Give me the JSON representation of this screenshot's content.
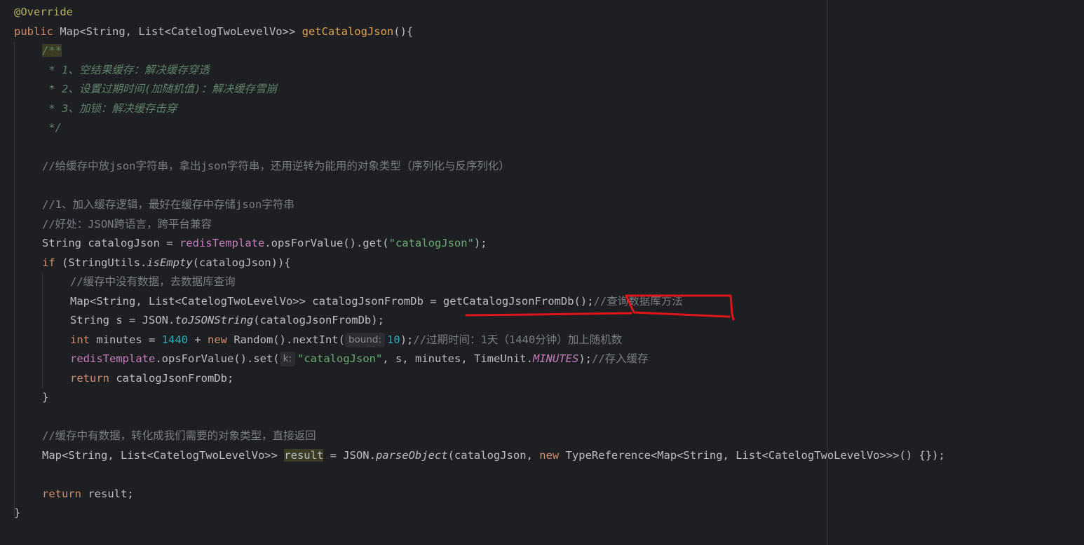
{
  "code": {
    "l1_annotation": "@Override",
    "l2_public": "public",
    "l2_type": " Map<String, List<CatelogTwoLevelVo>> ",
    "l2_method": "getCatalogJson",
    "l2_end": "(){",
    "l3_doc_open": "/**",
    "l4_doc": " * 1、空结果缓存：解决缓存穿透",
    "l5_doc": " * 2、设置过期时间(加随机值)：解决缓存雪崩",
    "l6_doc": " * 3、加锁：解决缓存击穿",
    "l7_doc": " */",
    "l9_comment": "//给缓存中放json字符串，拿出json字符串，还用逆转为能用的对象类型（序列化与反序列化）",
    "l11_comment": "//1、加入缓存逻辑，最好在缓存中存储json字符串",
    "l12_comment": "//好处：JSON跨语言，跨平台兼容",
    "l13_a": "String catalogJson = ",
    "l13_field": "redisTemplate",
    "l13_b": ".opsForValue().get(",
    "l13_str": "\"catalogJson\"",
    "l13_c": ");",
    "l14_if": "if",
    "l14_a": " (StringUtils.",
    "l14_fn": "isEmpty",
    "l14_b": "(catalogJson)){",
    "l15_comment": "//缓存中没有数据，去数据库查询",
    "l16_code": "Map<String, List<CatelogTwoLevelVo>> catalogJsonFromDb = getCatalogJsonFromDb();",
    "l16_comment": "//查询数据库方法",
    "l17_a": "String s = JSON.",
    "l17_fn": "toJSONString",
    "l17_b": "(catalogJsonFromDb);",
    "l18_int": "int",
    "l18_a": " minutes = ",
    "l18_num1": "1440",
    "l18_b": " + ",
    "l18_new": "new",
    "l18_c": " Random().nextInt(",
    "l18_hint": "bound:",
    "l18_num2": "10",
    "l18_d": ");",
    "l18_comment": "//过期时间：1天（1440分钟）加上随机数",
    "l19_field": "redisTemplate",
    "l19_a": ".opsForValue().set(",
    "l19_hint": "k:",
    "l19_str": "\"catalogJson\"",
    "l19_b": ", s, minutes, TimeUnit.",
    "l19_const": "MINUTES",
    "l19_c": ");",
    "l19_comment": "//存入缓存",
    "l20_return": "return",
    "l20_a": " catalogJsonFromDb;",
    "l21_close": "}",
    "l23_comment": "//缓存中有数据，转化成我们需要的对象类型，直接返回",
    "l24_a": "Map<String, List<CatelogTwoLevelVo>> ",
    "l24_var": "result",
    "l24_b": " = JSON.",
    "l24_fn": "parseObject",
    "l24_c": "(catalogJson, ",
    "l24_new": "new",
    "l24_d": " TypeReference<Map<String, List<CatelogTwoLevelVo>>>() {});",
    "l26_return": "return",
    "l26_a": " result;",
    "l27_close": "}"
  },
  "colors": {
    "background": "#1e1f22",
    "keyword": "#cf8e6d",
    "string": "#6aab73",
    "number": "#2aacb8",
    "comment": "#7a7e85",
    "method": "#e0a257",
    "field": "#c77dbb",
    "annotation_mark": "#e0151b"
  }
}
